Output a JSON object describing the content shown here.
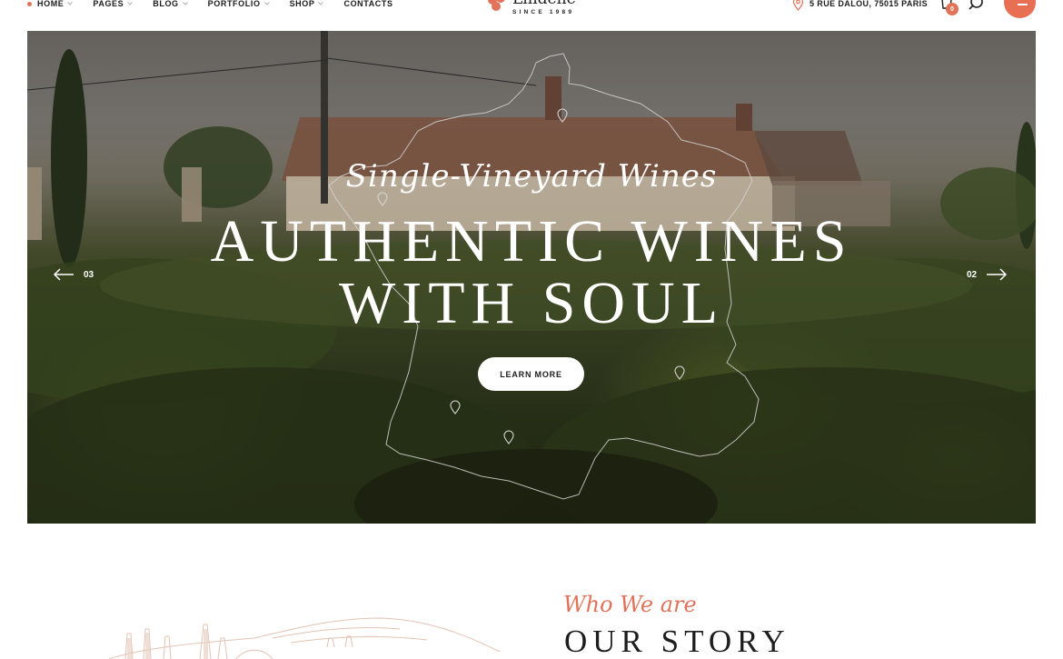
{
  "header": {
    "nav": [
      {
        "label": "HOME",
        "active": true,
        "dropdown": true
      },
      {
        "label": "PAGES",
        "active": false,
        "dropdown": true
      },
      {
        "label": "BLOG",
        "active": false,
        "dropdown": true
      },
      {
        "label": "PORTFOLIO",
        "active": false,
        "dropdown": true
      },
      {
        "label": "SHOP",
        "active": false,
        "dropdown": true
      },
      {
        "label": "CONTACTS",
        "active": false,
        "dropdown": false
      }
    ],
    "logo": {
      "name": "Lindene",
      "tagline": "SINCE 1989"
    },
    "address": "5 RUE DALOU, 75015 PARIS",
    "cart_count": "0",
    "icons": {
      "address": "location-pin-icon",
      "cart": "shopping-bag-icon",
      "search": "search-icon",
      "menu": "hamburger-icon"
    }
  },
  "hero": {
    "script": "Single-Vineyard Wines",
    "title_line1": "AUTHENTIC WINES",
    "title_line2": "WITH SOUL",
    "button": "LEARN MORE",
    "prev_slide": "03",
    "next_slide": "02"
  },
  "story": {
    "script": "Who We are",
    "title": "OUR STORY"
  },
  "colors": {
    "accent": "#e0735a",
    "text": "#1d1d1d",
    "background": "#ffffff"
  }
}
